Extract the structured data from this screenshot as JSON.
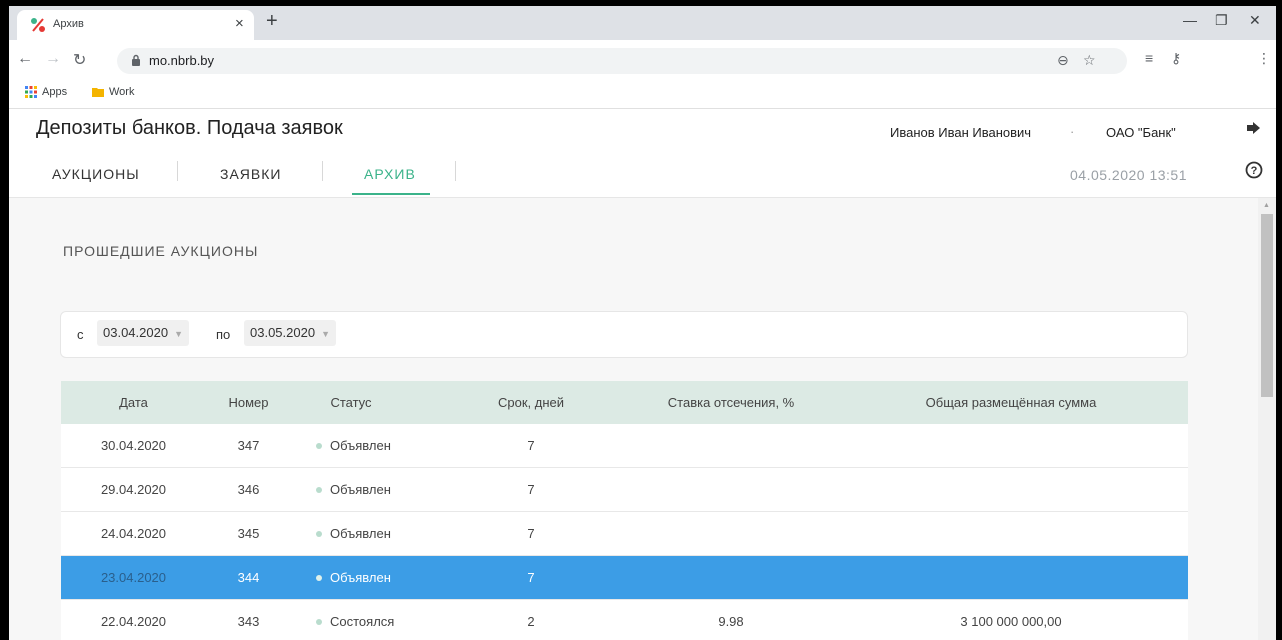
{
  "browser": {
    "tab_title": "Архив",
    "url": "mo.nbrb.by",
    "bookmarks": [
      "Apps",
      "Work"
    ]
  },
  "header": {
    "title": "Депозиты банков. Подача заявок",
    "user": "Иванов Иван Иванович",
    "separator": "·",
    "org": "ОАО \"Банк\"",
    "datetime": "04.05.2020 13:51",
    "nav": [
      "АУКЦИОНЫ",
      "ЗАЯВКИ",
      "АРХИВ"
    ],
    "active_nav": "АРХИВ",
    "accent_color": "#3bb38a"
  },
  "content": {
    "section_title": "ПРОШЕДШИЕ АУКЦИОНЫ",
    "filter": {
      "from_label": "с",
      "from_value": "03.04.2020",
      "to_label": "по",
      "to_value": "03.05.2020"
    },
    "table": {
      "columns": [
        "Дата",
        "Номер",
        "Статус",
        "Срок, дней",
        "Ставка отсечения, %",
        "Общая размещённая сумма"
      ],
      "rows": [
        {
          "date": "30.04.2020",
          "number": "347",
          "status": "Объявлен",
          "term": "7",
          "rate": "",
          "sum": ""
        },
        {
          "date": "29.04.2020",
          "number": "346",
          "status": "Объявлен",
          "term": "7",
          "rate": "",
          "sum": ""
        },
        {
          "date": "24.04.2020",
          "number": "345",
          "status": "Объявлен",
          "term": "7",
          "rate": "",
          "sum": ""
        },
        {
          "date": "23.04.2020",
          "number": "344",
          "status": "Объявлен",
          "term": "7",
          "rate": "",
          "sum": ""
        },
        {
          "date": "22.04.2020",
          "number": "343",
          "status": "Состоялся",
          "term": "2",
          "rate": "9.98",
          "sum": "3 100 000 000,00"
        }
      ],
      "selected_row_index": 3,
      "selected_color": "#3c9de6"
    }
  }
}
